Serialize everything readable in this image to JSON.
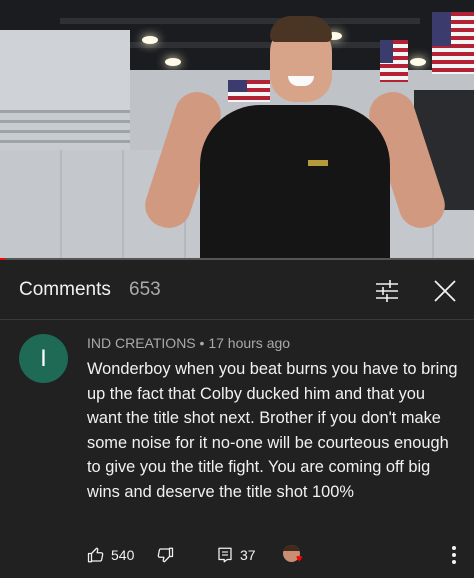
{
  "video": {
    "progress_fraction": 0.01
  },
  "comments_panel": {
    "title": "Comments",
    "count": "653",
    "filter_icon": "sort-filter-icon",
    "close_icon": "close-icon"
  },
  "comment": {
    "avatar_letter": "I",
    "avatar_color": "#1e6a55",
    "author": "IND CREATIONS",
    "separator": "•",
    "time": "17 hours ago",
    "text": "Wonderboy when you beat burns you have to bring up the fact that Colby ducked him and that you want the title shot next. Brother if you don't make some noise for it no-one will be courteous enough to give you the title fight. You are coming off big wins and deserve the title shot 100%",
    "likes": "540",
    "replies": "37",
    "creator_heart": true,
    "heart_color": "#ff0000"
  },
  "colors": {
    "background": "#212121",
    "text_primary": "#f1f1f1",
    "text_secondary": "#aaaaaa",
    "progress": "#ff0000"
  }
}
